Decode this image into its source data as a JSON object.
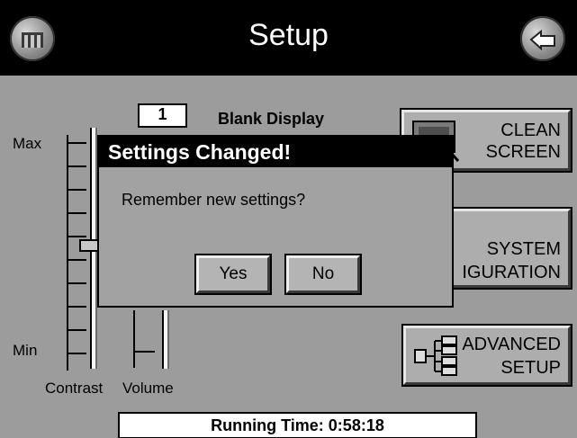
{
  "header": {
    "title": "Setup",
    "home_icon": "home-icon",
    "back_icon": "back-arrow-icon"
  },
  "contrast": {
    "max_label": "Max",
    "min_label": "Min",
    "label": "Contrast",
    "level": 0.5
  },
  "volume": {
    "value": "1",
    "label": "Volume"
  },
  "blank_display": {
    "label": "Blank Display"
  },
  "buttons": {
    "clean_screen": [
      "CLEAN",
      "SCREEN"
    ],
    "system_config": [
      "SYSTEM",
      "IGURATION"
    ],
    "advanced_setup": [
      "ADVANCED",
      "SETUP"
    ]
  },
  "dialog": {
    "title": "Settings Changed!",
    "message": "Remember new settings?",
    "yes": "Yes",
    "no": "No"
  },
  "status": {
    "running_time": "Running Time: 0:58:18"
  }
}
